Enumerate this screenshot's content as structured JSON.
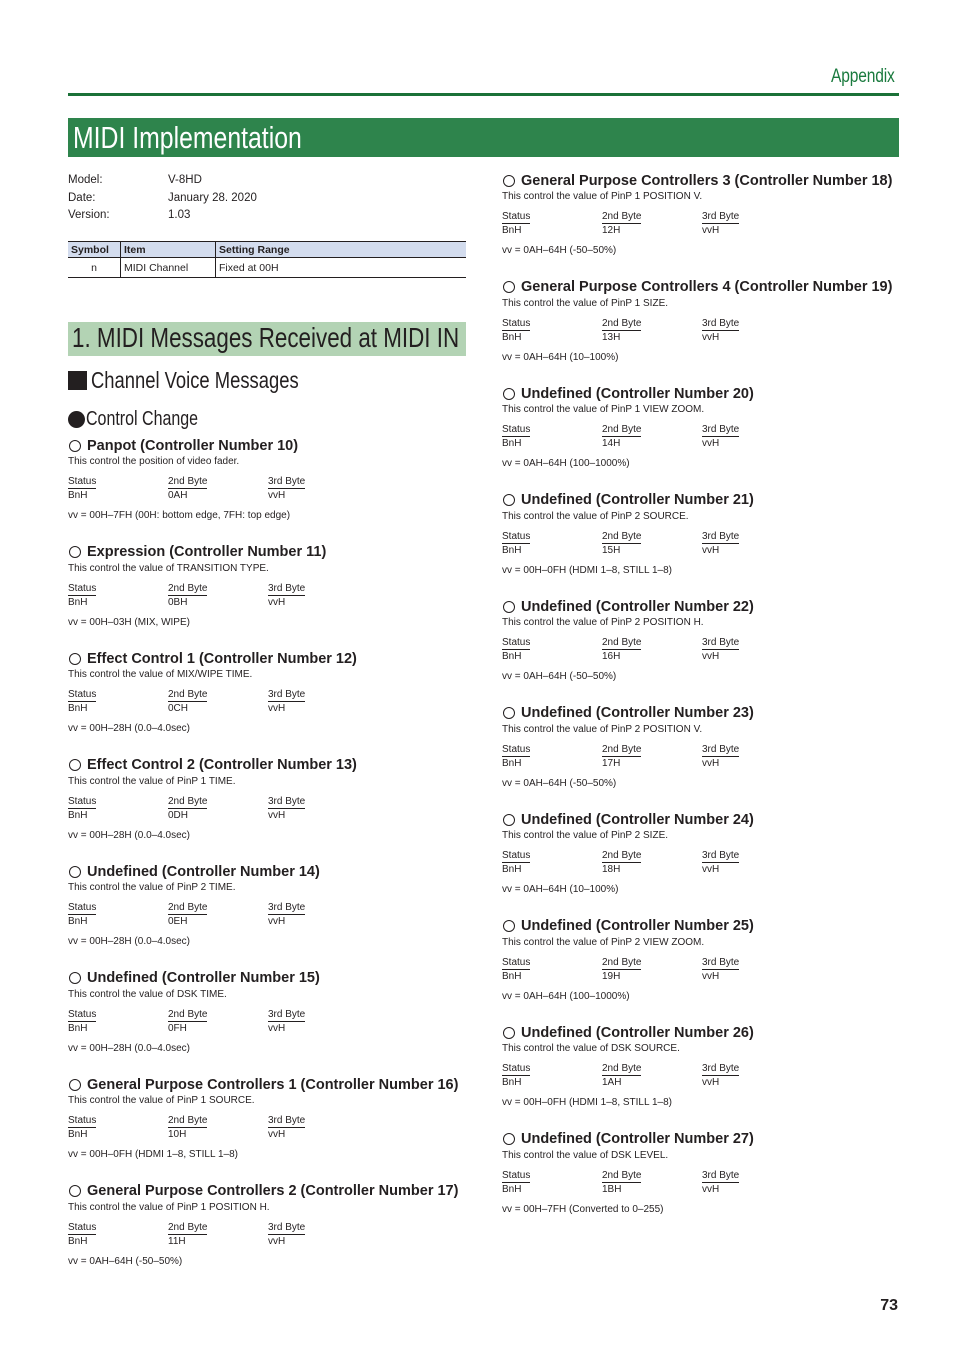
{
  "header": {
    "section_label": "Appendix",
    "title": "MIDI Implementation"
  },
  "meta": [
    {
      "key": "Model:",
      "value": "V-8HD"
    },
    {
      "key": "Date:",
      "value": "January 28. 2020"
    },
    {
      "key": "Version:",
      "value": "1.03"
    }
  ],
  "symbol_table": {
    "headers": [
      "Symbol",
      "Item",
      "Setting Range"
    ],
    "rows": [
      [
        "n",
        "MIDI Channel",
        "Fixed at 00H"
      ]
    ]
  },
  "section": {
    "title": "1. MIDI Messages Received at MIDI IN",
    "subheading": "Channel Voice Messages",
    "subsubheading": "Control Change"
  },
  "byte_headers": {
    "status": "Status",
    "second": "2nd Byte",
    "third": "3rd Byte"
  },
  "entries": [
    {
      "title": "Panpot (Controller Number 10)",
      "desc": "This control the position of video fader.",
      "status": "BnH",
      "second": "0AH",
      "third": "vvH",
      "range": "vv = 00H–7FH (00H: bottom edge, 7FH: top edge)"
    },
    {
      "title": "Expression (Controller Number 11)",
      "desc": "This control the value of TRANSITION TYPE.",
      "status": "BnH",
      "second": "0BH",
      "third": "vvH",
      "range": "vv = 00H–03H (MIX, WIPE)"
    },
    {
      "title": "Effect Control 1 (Controller Number 12)",
      "desc": "This control the value of MIX/WIPE TIME.",
      "status": "BnH",
      "second": "0CH",
      "third": "vvH",
      "range": "vv = 00H–28H (0.0–4.0sec)"
    },
    {
      "title": "Effect Control 2 (Controller Number 13)",
      "desc": "This control the value of PinP 1 TIME.",
      "status": "BnH",
      "second": "0DH",
      "third": "vvH",
      "range": "vv = 00H–28H (0.0–4.0sec)"
    },
    {
      "title": "Undefined (Controller Number 14)",
      "desc": "This control the value of PinP 2 TIME.",
      "status": "BnH",
      "second": "0EH",
      "third": "vvH",
      "range": "vv = 00H–28H (0.0–4.0sec)"
    },
    {
      "title": "Undefined (Controller Number 15)",
      "desc": "This control the value of DSK TIME.",
      "status": "BnH",
      "second": "0FH",
      "third": "vvH",
      "range": "vv = 00H–28H (0.0–4.0sec)"
    },
    {
      "title": "General Purpose Controllers 1 (Controller Number 16)",
      "desc": "This control the value of PinP 1 SOURCE.",
      "status": "BnH",
      "second": "10H",
      "third": "vvH",
      "range": "vv = 00H–0FH (HDMI 1–8, STILL 1–8)"
    },
    {
      "title": "General Purpose Controllers 2 (Controller Number 17)",
      "desc": "This control the value of PinP 1 POSITION H.",
      "status": "BnH",
      "second": "11H",
      "third": "vvH",
      "range": "vv = 0AH–64H (-50–50%)"
    },
    {
      "title": "General Purpose Controllers 3 (Controller Number 18)",
      "desc": "This control the value of PinP 1 POSITION V.",
      "status": "BnH",
      "second": "12H",
      "third": "vvH",
      "range": "vv = 0AH–64H (-50–50%)"
    },
    {
      "title": "General Purpose Controllers 4 (Controller Number 19)",
      "desc": "This control the value of PinP 1 SIZE.",
      "status": "BnH",
      "second": "13H",
      "third": "vvH",
      "range": "vv = 0AH–64H (10–100%)"
    },
    {
      "title": "Undefined (Controller Number 20)",
      "desc": "This control the value of PinP 1 VIEW ZOOM.",
      "status": "BnH",
      "second": "14H",
      "third": "vvH",
      "range": "vv = 0AH–64H (100–1000%)"
    },
    {
      "title": "Undefined (Controller Number 21)",
      "desc": "This control the value of PinP 2 SOURCE.",
      "status": "BnH",
      "second": "15H",
      "third": "vvH",
      "range": "vv = 00H–0FH (HDMI 1–8, STILL 1–8)"
    },
    {
      "title": "Undefined (Controller Number 22)",
      "desc": "This control the value of PinP 2 POSITION H.",
      "status": "BnH",
      "second": "16H",
      "third": "vvH",
      "range": "vv = 0AH–64H (-50–50%)"
    },
    {
      "title": "Undefined (Controller Number 23)",
      "desc": "This control the value of PinP 2 POSITION V.",
      "status": "BnH",
      "second": "17H",
      "third": "vvH",
      "range": "vv = 0AH–64H (-50–50%)"
    },
    {
      "title": "Undefined (Controller Number 24)",
      "desc": "This control the value of PinP 2 SIZE.",
      "status": "BnH",
      "second": "18H",
      "third": "vvH",
      "range": "vv = 0AH–64H (10–100%)"
    },
    {
      "title": "Undefined (Controller Number 25)",
      "desc": "This control the value of PinP 2 VIEW ZOOM.",
      "status": "BnH",
      "second": "19H",
      "third": "vvH",
      "range": "vv = 0AH–64H (100–1000%)"
    },
    {
      "title": "Undefined (Controller Number 26)",
      "desc": "This control the value of DSK SOURCE.",
      "status": "BnH",
      "second": "1AH",
      "third": "vvH",
      "range": "vv = 00H–0FH (HDMI 1–8, STILL 1–8)"
    },
    {
      "title": "Undefined (Controller Number 27)",
      "desc": "This control the value of DSK LEVEL.",
      "status": "BnH",
      "second": "1BH",
      "third": "vvH",
      "range": "vv = 00H–7FH (Converted to 0–255)"
    }
  ],
  "footer": {
    "page_number": "73"
  }
}
